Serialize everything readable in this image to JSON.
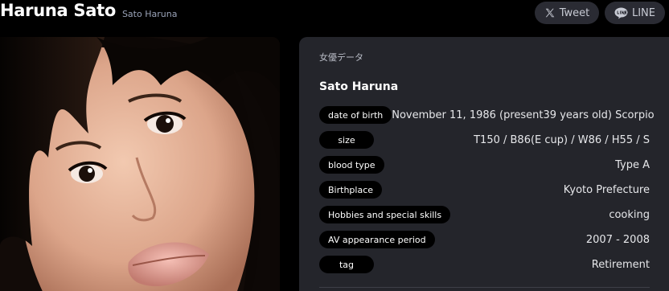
{
  "header": {
    "title": "Haruna Sato",
    "subtitle": "Sato Haruna"
  },
  "share": {
    "tweet_label": "Tweet",
    "tweet_icon": "x-logo-icon",
    "line_label": "LINE",
    "line_icon": "line-logo-icon"
  },
  "profile_photo": {
    "alt": "Haruna Sato"
  },
  "panel": {
    "section_label": "女優データ",
    "name": "Sato Haruna",
    "rows": [
      {
        "label": "date of birth",
        "value": "November 11, 1986 (present39 years old) Scorpio"
      },
      {
        "label": "size",
        "value": "T150 / B86(E cup) / W86 / H55 / S"
      },
      {
        "label": "blood type",
        "value": "Type A"
      },
      {
        "label": "Birthplace",
        "value": "Kyoto Prefecture"
      },
      {
        "label": "Hobbies and special skills",
        "value": "cooking"
      },
      {
        "label": "AV appearance period",
        "value": "2007 - 2008"
      },
      {
        "label": "tag",
        "value": "Retirement"
      }
    ]
  },
  "colors": {
    "background": "#000000",
    "panel": "#24252b",
    "tag_bg": "#000000",
    "button_bg": "#2a2b33",
    "subtitle": "#9aa3b8"
  }
}
